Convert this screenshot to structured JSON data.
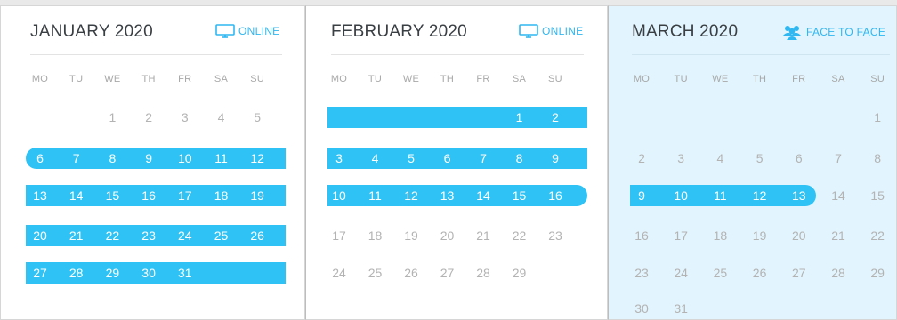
{
  "colors": {
    "accent": "#2fc2f5",
    "panel_tint": "#e2f4fd"
  },
  "calendars": [
    {
      "title": "JANUARY 2020",
      "badge": {
        "label": "ONLINE",
        "icon": "monitor-icon"
      },
      "weekdays": [
        "MO",
        "TU",
        "WE",
        "TH",
        "FR",
        "SA",
        "SU"
      ],
      "weeks": [
        [
          "",
          "",
          "1",
          "2",
          "3",
          "4",
          "5"
        ],
        [
          "6",
          "7",
          "8",
          "9",
          "10",
          "11",
          "12"
        ],
        [
          "13",
          "14",
          "15",
          "16",
          "17",
          "18",
          "19"
        ],
        [
          "20",
          "21",
          "22",
          "23",
          "24",
          "25",
          "26"
        ],
        [
          "27",
          "28",
          "29",
          "30",
          "31",
          "",
          ""
        ]
      ],
      "highlighted_weeks": [
        1,
        2,
        3,
        4
      ]
    },
    {
      "title": "FEBRUARY 2020",
      "badge": {
        "label": "ONLINE",
        "icon": "monitor-icon"
      },
      "weekdays": [
        "MO",
        "TU",
        "WE",
        "TH",
        "FR",
        "SA",
        "SU"
      ],
      "weeks": [
        [
          "",
          "",
          "",
          "",
          "",
          "1",
          "2"
        ],
        [
          "3",
          "4",
          "5",
          "6",
          "7",
          "8",
          "9"
        ],
        [
          "10",
          "11",
          "12",
          "13",
          "14",
          "15",
          "16"
        ],
        [
          "17",
          "18",
          "19",
          "20",
          "21",
          "22",
          "23"
        ],
        [
          "24",
          "25",
          "26",
          "27",
          "28",
          "29",
          ""
        ]
      ],
      "highlighted_weeks": [
        0,
        1,
        2
      ]
    },
    {
      "title": "MARCH 2020",
      "badge": {
        "label": "FACE TO FACE",
        "icon": "people-icon"
      },
      "weekdays": [
        "MO",
        "TU",
        "WE",
        "TH",
        "FR",
        "SA",
        "SU"
      ],
      "weeks": [
        [
          "",
          "",
          "",
          "",
          "",
          "",
          "1"
        ],
        [
          "2",
          "3",
          "4",
          "5",
          "6",
          "7",
          "8"
        ],
        [
          "9",
          "10",
          "11",
          "12",
          "13",
          "14",
          "15"
        ],
        [
          "16",
          "17",
          "18",
          "19",
          "20",
          "21",
          "22"
        ],
        [
          "23",
          "24",
          "25",
          "26",
          "27",
          "28",
          "29"
        ],
        [
          "30",
          "31",
          "",
          "",
          "",
          "",
          ""
        ]
      ],
      "highlighted_weeks": [
        2
      ]
    }
  ]
}
